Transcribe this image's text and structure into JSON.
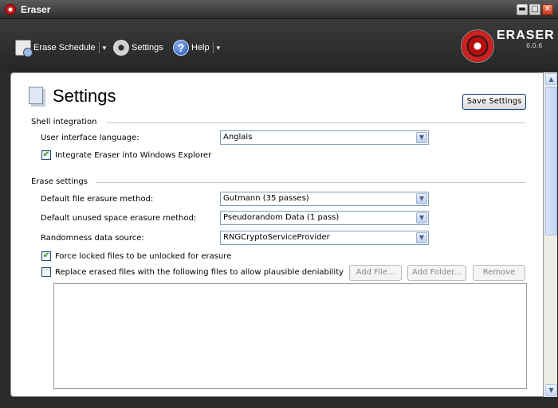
{
  "window": {
    "title": "Eraser",
    "controls": {
      "minimize": "▬",
      "maximize": "□",
      "close": "✕"
    }
  },
  "toolbar": {
    "erase_schedule": "Erase Schedule",
    "settings": "Settings",
    "help": "Help",
    "caret": "▾"
  },
  "logo": {
    "name": "ERASER",
    "version": "6.0.6"
  },
  "page": {
    "title": "Settings",
    "save_button": "Save Settings"
  },
  "shell_integration": {
    "heading": "Shell integration",
    "language_label": "User interface language:",
    "language_value": "Anglais",
    "integrate_label": "Integrate Eraser into Windows Explorer",
    "integrate_checked": true
  },
  "erase_settings": {
    "heading": "Erase settings",
    "file_method_label": "Default file erasure method:",
    "file_method_value": "Gutmann (35 passes)",
    "unused_method_label": "Default unused space erasure method:",
    "unused_method_value": "Pseudorandom Data (1 pass)",
    "randomness_label": "Randomness data source:",
    "randomness_value": "RNGCryptoServiceProvider",
    "force_unlock_label": "Force locked files to be unlocked for erasure",
    "force_unlock_checked": true,
    "replace_label": "Replace erased files with the following files to allow plausible deniability",
    "replace_checked": false,
    "add_file": "Add File...",
    "add_folder": "Add Folder...",
    "remove": "Remove"
  },
  "glyphs": {
    "check": "✔",
    "dropdown": "▼",
    "scroll_up": "▲",
    "scroll_down": "▼",
    "help_q": "?"
  },
  "colors": {
    "accent_red": "#c51a1a",
    "toolbar_dark": "#2b2b2b",
    "check_green": "#21a121"
  }
}
